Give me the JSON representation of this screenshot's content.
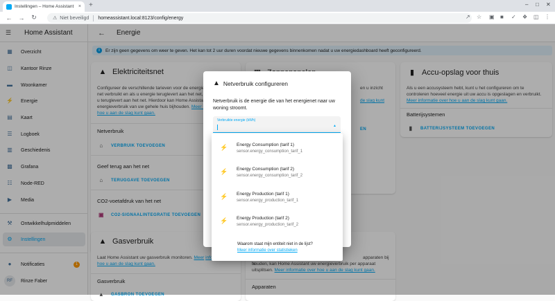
{
  "browser": {
    "tab_title": "Instellingen – Home Assistant",
    "tab_close": "×",
    "new_tab": "+",
    "security": "Niet beveiligd",
    "url": "homeassistant.local:8123/config/energy"
  },
  "sidebar": {
    "app_name": "Home Assistant",
    "items": [
      {
        "label": "Overzicht",
        "icon": "grid-icon"
      },
      {
        "label": "Kantoor Rinze",
        "icon": "chair-icon"
      },
      {
        "label": "Woonkamer",
        "icon": "sofa-icon"
      },
      {
        "label": "Energie",
        "icon": "lightning-icon"
      },
      {
        "label": "Kaart",
        "icon": "map-icon"
      },
      {
        "label": "Logboek",
        "icon": "list-icon"
      },
      {
        "label": "Geschiedenis",
        "icon": "chart-icon"
      },
      {
        "label": "Grafana",
        "icon": "grafana-icon"
      },
      {
        "label": "Node-RED",
        "icon": "sitemap-icon"
      },
      {
        "label": "Media",
        "icon": "play-icon"
      }
    ],
    "dev_tools": "Ontwikkelhulpmiddelen",
    "settings": "Instellingen",
    "notifications": "Notificaties",
    "notifications_count": "1",
    "user_initials": "RF",
    "user_name": "Rinze Faber"
  },
  "page": {
    "title": "Energie",
    "alert": "Er zijn geen gegevens om weer te geven. Het kan tot 2 uur duren voordat nieuwe gegevens binnenkomen nadat u uw energiedashboard heeft geconfigureerd."
  },
  "grid_card": {
    "title": "Elektriciteitsnet",
    "desc": "Configureer de verschillende tarieven voor de energie die u uit het net verbruikt en als u energie teruglevert aan het net, de energie die u teruglevert aan het net. Hierdoor kan Home Assistant het energieverbruik van uw gehele huis bijhouden.",
    "link": "Meer informatie over hoe u aan de slag kunt gaan.",
    "consumption_heading": "Netverbruik",
    "add_consumption": "VERBRUIK TOEVOEGEN",
    "return_heading": "Geef terug aan het net",
    "add_return": "TERUGGAVE TOEVOEGEN",
    "co2_heading": "CO2-voetafdruk van het net",
    "add_co2": "CO2-SIGNAALINTEGRATIE TOEVOEGEN"
  },
  "solar_card": {
    "title": "Zonnepanelen",
    "desc_visible": "en u inzicht",
    "desc_visible2": "de slag kunt",
    "add": "EN"
  },
  "battery_card": {
    "title": "Accu-opslag voor thuis",
    "desc": "Als u een accusysteem hebt, kunt u het configureren om te controleren hoeveel energie uit uw accu is opgeslagen en verbruikt.",
    "link": "Meer informatie over hoe u aan de slag kunt gaan.",
    "systems_heading": "Batterijsystemen",
    "add": "BATTERIJSYSTEEM TOEVOEGEN"
  },
  "gas_card": {
    "title": "Gasverbruik",
    "desc": "Laat Home Assistant uw gasverbruik monitoren.",
    "desc_link_part": "Meer",
    "link": "informatie over hoe u aan de slag kunt gaan.",
    "heading": "Gasverbruik",
    "add": "GASBRON TOEVOEGEN"
  },
  "devices_card": {
    "desc": "apparaten bij te houden, kan Home Assistant uw energieverbruik per apparaat uitsplitsen.",
    "desc_first": "apparaten bij te",
    "link": "Meer informatie over hoe u aan de slag kunt gaan.",
    "heading": "Apparaten"
  },
  "dialog": {
    "title": "Netverbruik configureren",
    "desc": "Netverbruik is de energie die van het energienet naar uw woning stroomt.",
    "field_label": "Verbruikte energie (kWh)",
    "options": [
      {
        "name": "Energy Consumption (tarif 1)",
        "id": "sensor.energy_consumption_tarif_1"
      },
      {
        "name": "Energy Consumption (tarif 2)",
        "id": "sensor.energy_consumption_tarif_2"
      },
      {
        "name": "Energy Production (tarif 1)",
        "id": "sensor.energy_production_tarif_1"
      },
      {
        "name": "Energy Production (tarif 2)",
        "id": "sensor.energy_production_tarif_2"
      }
    ],
    "footer_question": "Waarom staat mijn entiteit niet in de lijst?",
    "footer_link": "Meer informatie over statistieken"
  },
  "colors": {
    "accent": "#03a9f4",
    "icon": "#44739e",
    "warning": "#ff9800"
  }
}
